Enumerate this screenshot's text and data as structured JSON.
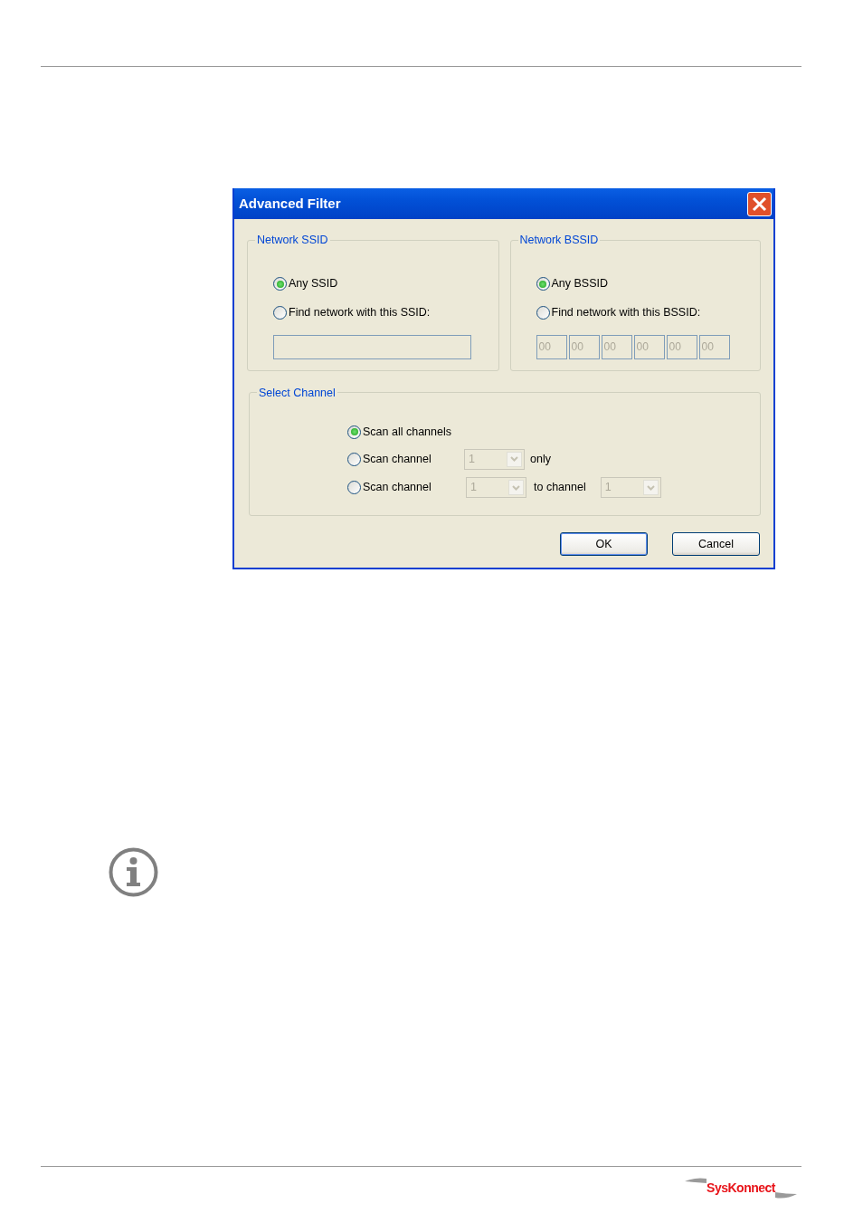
{
  "dialog": {
    "title": "Advanced Filter",
    "ssid_group": {
      "legend": "Network SSID",
      "options": [
        {
          "label": "Any SSID",
          "selected": true
        },
        {
          "label": "Find network with this SSID:",
          "selected": false
        }
      ]
    },
    "bssid_group": {
      "legend": "Network BSSID",
      "options": [
        {
          "label": "Any BSSID",
          "selected": true
        },
        {
          "label": "Find network with this BSSID:",
          "selected": false
        }
      ],
      "octets": [
        "00",
        "00",
        "00",
        "00",
        "00",
        "00"
      ],
      "octets_disabled": true
    },
    "channel_group": {
      "legend": "Select Channel",
      "options": [
        {
          "kind": "plain",
          "label": "Scan all channels",
          "selected": true
        },
        {
          "kind": "single",
          "label": "Scan channel",
          "selected": false,
          "from": "1",
          "suffix": "only",
          "disabled": true
        },
        {
          "kind": "range",
          "label": "Scan channel",
          "selected": false,
          "from": "1",
          "suffix": "to channel",
          "to": "1",
          "disabled": true
        }
      ]
    },
    "buttons": [
      {
        "label": "OK",
        "default": true
      },
      {
        "label": "Cancel",
        "default": false
      }
    ]
  },
  "logo": {
    "text": "SysKonnect"
  }
}
